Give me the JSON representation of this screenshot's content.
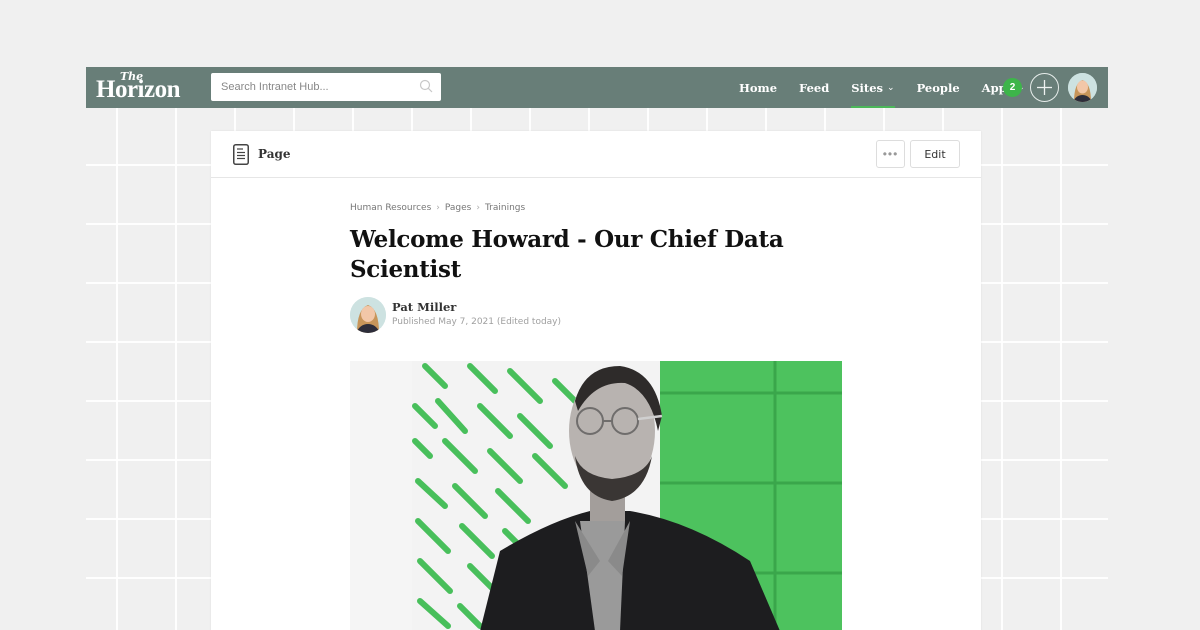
{
  "navbar": {
    "logo_small": "The",
    "logo_name": "Horizon",
    "search_placeholder": "Search Intranet Hub...",
    "links": [
      {
        "label": "Home",
        "dropdown": false,
        "active": false
      },
      {
        "label": "Feed",
        "dropdown": false,
        "active": false
      },
      {
        "label": "Sites",
        "dropdown": true,
        "active": true
      },
      {
        "label": "People",
        "dropdown": false,
        "active": false
      },
      {
        "label": "Apps",
        "dropdown": true,
        "active": false
      }
    ],
    "notification_count": "2",
    "brand_color": "#687e78",
    "accent_color": "#3db54a"
  },
  "page_header": {
    "type_label": "Page",
    "more_label": "•••",
    "edit_label": "Edit"
  },
  "article": {
    "breadcrumb": [
      "Human Resources",
      "Pages",
      "Trainings"
    ],
    "title": "Welcome Howard - Our Chief Data Scientist",
    "author": "Pat Miller",
    "published": "Published May 7, 2021 (Edited today)",
    "hero_alt": "Portrait of Howard, bearded man with glasses in dark blazer on green patterned background"
  }
}
